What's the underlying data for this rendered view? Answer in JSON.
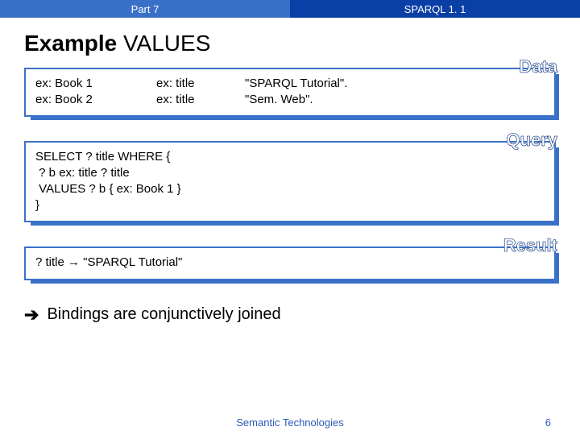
{
  "header": {
    "left": "Part 7",
    "right": "SPARQL 1. 1"
  },
  "title": {
    "bold": "Example",
    "rest": " VALUES"
  },
  "boxes": {
    "data": {
      "badge": "Data",
      "rows": [
        {
          "s": "ex: Book 1",
          "p": "ex: title",
          "o": "\"SPARQL Tutorial\"."
        },
        {
          "s": "ex: Book 2",
          "p": "ex: title",
          "o": "\"Sem. Web\"."
        }
      ]
    },
    "query": {
      "badge": "Query",
      "text": "SELECT ? title WHERE {\n ? b ex: title ? title\n VALUES ? b { ex: Book 1 }\n}"
    },
    "result": {
      "badge": "Result",
      "text": "? title → \"SPARQL Tutorial\""
    }
  },
  "bullet": "Bindings are conjunctively joined",
  "footer": {
    "text": "Semantic Technologies",
    "page": "6"
  }
}
